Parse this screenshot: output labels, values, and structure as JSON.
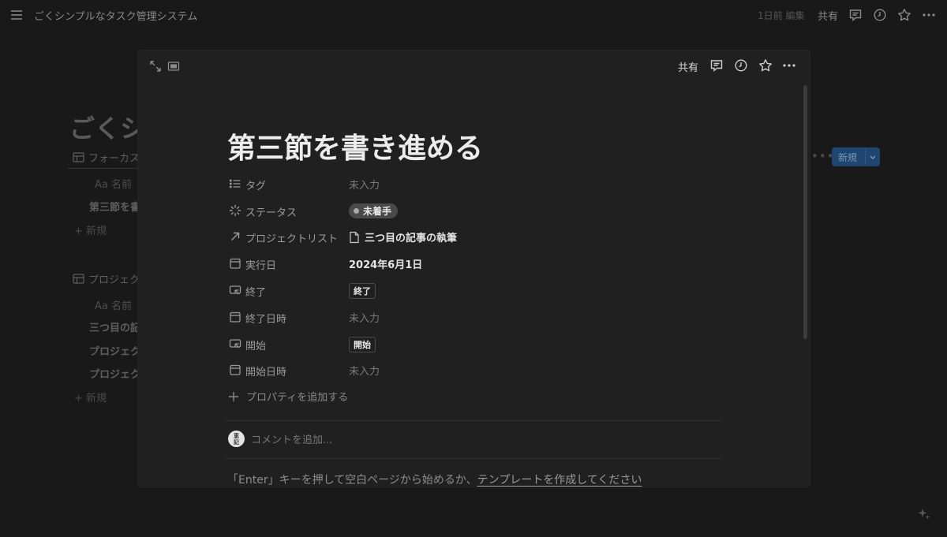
{
  "topbar": {
    "title": "ごくシンプルなタスク管理システム",
    "edited": "1日前 編集",
    "share": "共有"
  },
  "background": {
    "page_title": "ごくシ",
    "views": [
      {
        "label": "フォーカス",
        "header": "Aa 名前",
        "rows": [
          "第三節を書"
        ],
        "new": "+ 新規"
      },
      {
        "label": "プロジェク",
        "header": "Aa 名前",
        "rows": [
          "三つ目の記",
          "プロジェク",
          "プロジェク"
        ],
        "new": "+ 新規"
      }
    ],
    "new_button": "新規"
  },
  "modal": {
    "share": "共有",
    "title": "第三節を書き進める",
    "properties": {
      "tags": {
        "name": "タグ",
        "value": "未入力",
        "icon": "list-icon"
      },
      "status": {
        "name": "ステータス",
        "value": "未着手",
        "icon": "status-icon"
      },
      "project": {
        "name": "プロジェクトリスト",
        "value": "三つ目の記事の執筆",
        "icon": "relation-arrow-icon"
      },
      "exec_date": {
        "name": "実行日",
        "value": "2024年6月1日",
        "icon": "calendar-icon"
      },
      "finish": {
        "name": "終了",
        "value": "終了",
        "icon": "button-icon"
      },
      "finish_time": {
        "name": "終了日時",
        "value": "未入力",
        "icon": "calendar-icon"
      },
      "start": {
        "name": "開始",
        "value": "開始",
        "icon": "button-icon"
      },
      "start_time": {
        "name": "開始日時",
        "value": "未入力",
        "icon": "calendar-icon"
      }
    },
    "add_property": "プロパティを追加する",
    "avatar_text_1": "恵",
    "avatar_text_2": "記",
    "comment_placeholder": "コメントを追加...",
    "hint_prefix": "「Enter」キーを押して空白ページから始めるか、",
    "hint_link": "テンプレートを作成してください"
  }
}
